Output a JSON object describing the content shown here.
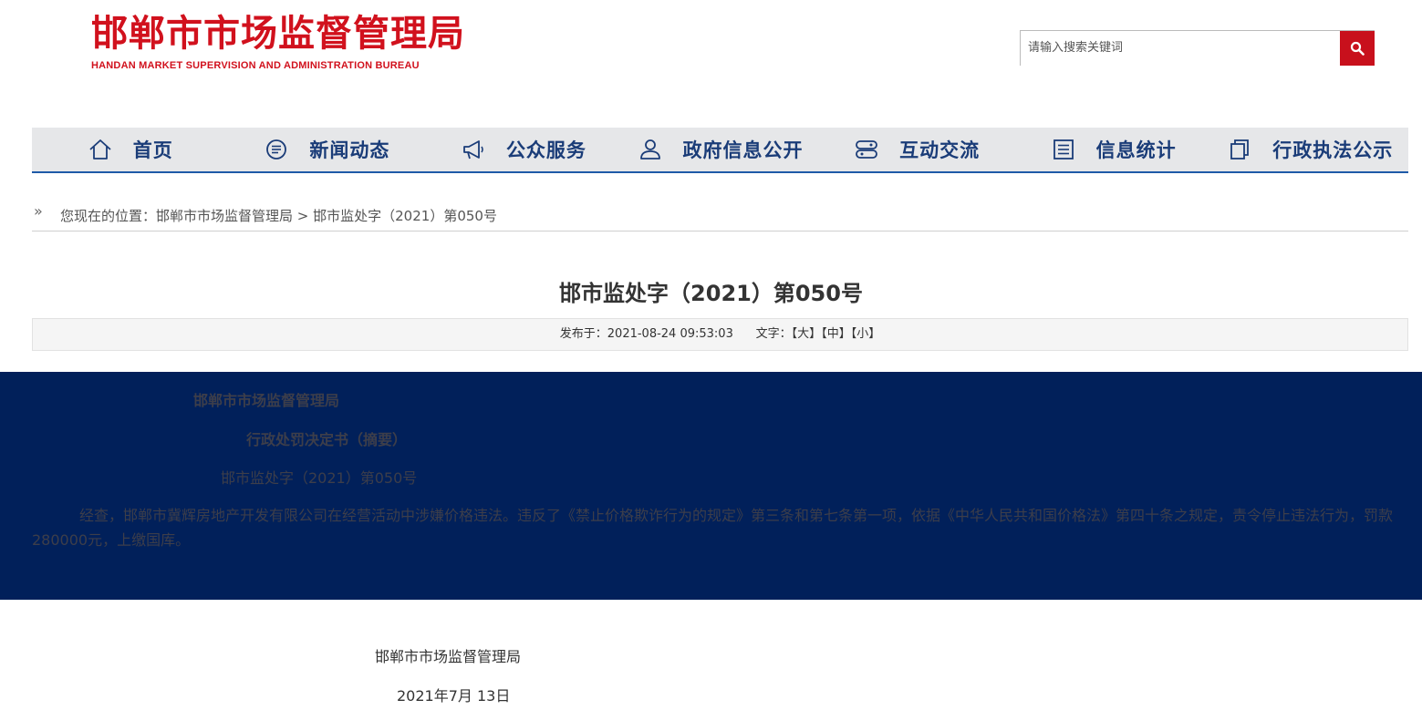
{
  "header": {
    "logo_cn": "邯郸市市场监督管理局",
    "logo_en": "HANDAN MARKET SUPERVISION AND ADMINISTRATION BUREAU",
    "search_placeholder": "请输入搜索关键词",
    "brand_color": "#d1111d"
  },
  "nav": {
    "items": [
      {
        "label": "首页",
        "icon": "home-icon"
      },
      {
        "label": "新闻动态",
        "icon": "news-icon"
      },
      {
        "label": "公众服务",
        "icon": "megaphone-icon"
      },
      {
        "label": "政府信息公开",
        "icon": "user-icon"
      },
      {
        "label": "互动交流",
        "icon": "interaction-icon"
      },
      {
        "label": "信息统计",
        "icon": "list-icon"
      },
      {
        "label": "行政执法公示",
        "icon": "copy-icon"
      }
    ],
    "text_color": "#1a3c78",
    "accent": "#1e5aa8"
  },
  "breadcrumb": {
    "prefix": "您现在的位置：",
    "home": "邯郸市市场监督管理局",
    "sep": " > ",
    "current": "邯市监处字（2021）第050号"
  },
  "article": {
    "title": "邯市监处字（2021）第050号",
    "published_label": "发布于：",
    "published": "2021-08-24 09:53:03",
    "fontsize_label": "文字：",
    "size_large": "【大】",
    "size_medium": "【中】",
    "size_small": "【小】",
    "body": {
      "agency": "邯郸市市场监督管理局",
      "doc_type": "行政处罚决定书（摘要）",
      "doc_no": "邯市监处字（2021）第050号",
      "content": "经查，邯郸市冀辉房地产开发有限公司在经营活动中涉嫌价格违法。违反了《禁止价格欺诈行为的规定》第三条和第七条第一项，依据《中华人民共和国价格法》第四十条之规定，责令停止违法行为，罚款280000元，上缴国库。",
      "band_color": "#01205a"
    },
    "signature": "邯郸市市场监督管理局",
    "date": "2021年7月 13日"
  }
}
